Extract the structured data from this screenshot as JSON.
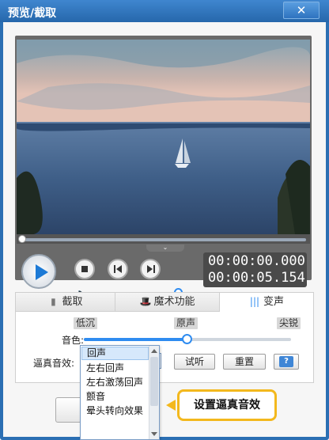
{
  "window": {
    "title": "预览/截取",
    "close_label": "✕"
  },
  "player": {
    "current_time": "00:00:00.000",
    "total_time": "00:00:05.154",
    "seek_position": 0.0,
    "volume_level": 1.0,
    "collapse_glyph": "⌄",
    "volume_icon_glyph": "🔈"
  },
  "tabs": [
    {
      "label": "截取",
      "icon": "clip-icon",
      "glyph": "▮"
    },
    {
      "label": "魔术功能",
      "icon": "magic-hat-icon",
      "glyph": "🎩"
    },
    {
      "label": "变声",
      "icon": "voice-wave-icon",
      "glyph": "|||"
    }
  ],
  "voice_panel": {
    "tone_label": "音色:",
    "tone_low": "低沉",
    "tone_mid": "原声",
    "tone_high": "尖锐",
    "tone_value": 0.5,
    "effect_label": "逼真音效:",
    "effect_selected": "回声",
    "listen_button": "试听",
    "reset_button": "重置",
    "help_glyph": "?"
  },
  "dropdown": {
    "items": [
      "回声",
      "左右回声",
      "左右激荡回声",
      "颤音",
      "晕头转向效果"
    ]
  },
  "callout": {
    "text": "设置逼真音效"
  },
  "colors": {
    "title_bar": "#2b6fb3",
    "accent": "#2f8cf0",
    "callout_border": "#f3b81d"
  }
}
